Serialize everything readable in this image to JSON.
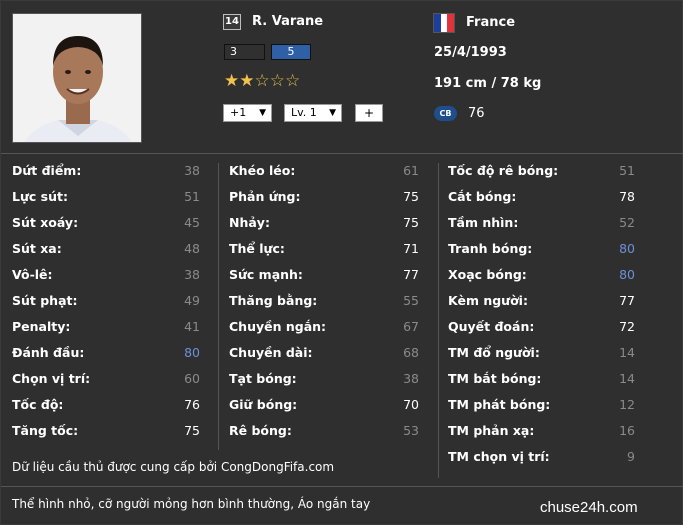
{
  "player": {
    "number": "14",
    "name": "R. Varane",
    "rank_left": "3",
    "rank_right": "5",
    "stars_filled": 2,
    "stars_total": 5,
    "upgrade_select": "+1",
    "level_select": "Lv. 1",
    "plus_label": "+",
    "country": "France",
    "dob": "25/4/1993",
    "height_weight": "191 cm / 78 kg",
    "position": "CB",
    "position_rating": "76"
  },
  "colors": {
    "gray_value": "#8a8a8a",
    "white_value": "#ffffff",
    "blue_value": "#6f8fd8",
    "flag_blue": "#1f3d9a",
    "flag_white": "#ffffff",
    "flag_red": "#e0343c"
  },
  "stats": {
    "col1": [
      {
        "label": "Dứt điểm:",
        "value": "38",
        "tone": "gray"
      },
      {
        "label": "Lực sút:",
        "value": "51",
        "tone": "gray"
      },
      {
        "label": "Sút xoáy:",
        "value": "45",
        "tone": "gray"
      },
      {
        "label": "Sút xa:",
        "value": "48",
        "tone": "gray"
      },
      {
        "label": "Vô-lê:",
        "value": "38",
        "tone": "gray"
      },
      {
        "label": "Sút phạt:",
        "value": "49",
        "tone": "gray"
      },
      {
        "label": "Penalty:",
        "value": "41",
        "tone": "gray"
      },
      {
        "label": "Đánh đầu:",
        "value": "80",
        "tone": "blue"
      },
      {
        "label": "Chọn vị trí:",
        "value": "60",
        "tone": "gray"
      },
      {
        "label": "Tốc độ:",
        "value": "76",
        "tone": "white"
      },
      {
        "label": "Tăng tốc:",
        "value": "75",
        "tone": "white"
      }
    ],
    "col2": [
      {
        "label": "Khéo léo:",
        "value": "61",
        "tone": "gray"
      },
      {
        "label": "Phản ứng:",
        "value": "75",
        "tone": "white"
      },
      {
        "label": "Nhảy:",
        "value": "75",
        "tone": "white"
      },
      {
        "label": "Thể lực:",
        "value": "71",
        "tone": "white"
      },
      {
        "label": "Sức mạnh:",
        "value": "77",
        "tone": "white"
      },
      {
        "label": "Thăng bằng:",
        "value": "55",
        "tone": "gray"
      },
      {
        "label": "Chuyền ngắn:",
        "value": "67",
        "tone": "gray"
      },
      {
        "label": "Chuyền dài:",
        "value": "68",
        "tone": "gray"
      },
      {
        "label": "Tạt bóng:",
        "value": "38",
        "tone": "gray"
      },
      {
        "label": "Giữ bóng:",
        "value": "70",
        "tone": "white"
      },
      {
        "label": "Rê bóng:",
        "value": "53",
        "tone": "gray"
      }
    ],
    "col3": [
      {
        "label": "Tốc độ rê bóng:",
        "value": "51",
        "tone": "gray"
      },
      {
        "label": "Cắt bóng:",
        "value": "78",
        "tone": "white"
      },
      {
        "label": "Tầm nhìn:",
        "value": "52",
        "tone": "gray"
      },
      {
        "label": "Tranh bóng:",
        "value": "80",
        "tone": "blue"
      },
      {
        "label": "Xoạc bóng:",
        "value": "80",
        "tone": "blue"
      },
      {
        "label": "Kèm người:",
        "value": "77",
        "tone": "white"
      },
      {
        "label": "Quyết đoán:",
        "value": "72",
        "tone": "white"
      },
      {
        "label": "TM đổ người:",
        "value": "14",
        "tone": "gray"
      },
      {
        "label": "TM bắt bóng:",
        "value": "14",
        "tone": "gray"
      },
      {
        "label": "TM phát bóng:",
        "value": "12",
        "tone": "gray"
      },
      {
        "label": "TM phản xạ:",
        "value": "16",
        "tone": "gray"
      },
      {
        "label": "TM chọn vị trí:",
        "value": "9",
        "tone": "gray"
      }
    ]
  },
  "footer": {
    "source": "Dữ liệu cầu thủ được cung cấp bởi CongDongFifa.com",
    "description": "Thể hình nhỏ, cỡ người mỏng hơn bình thường, Áo ngắn tay",
    "site": "chuse24h.com"
  }
}
